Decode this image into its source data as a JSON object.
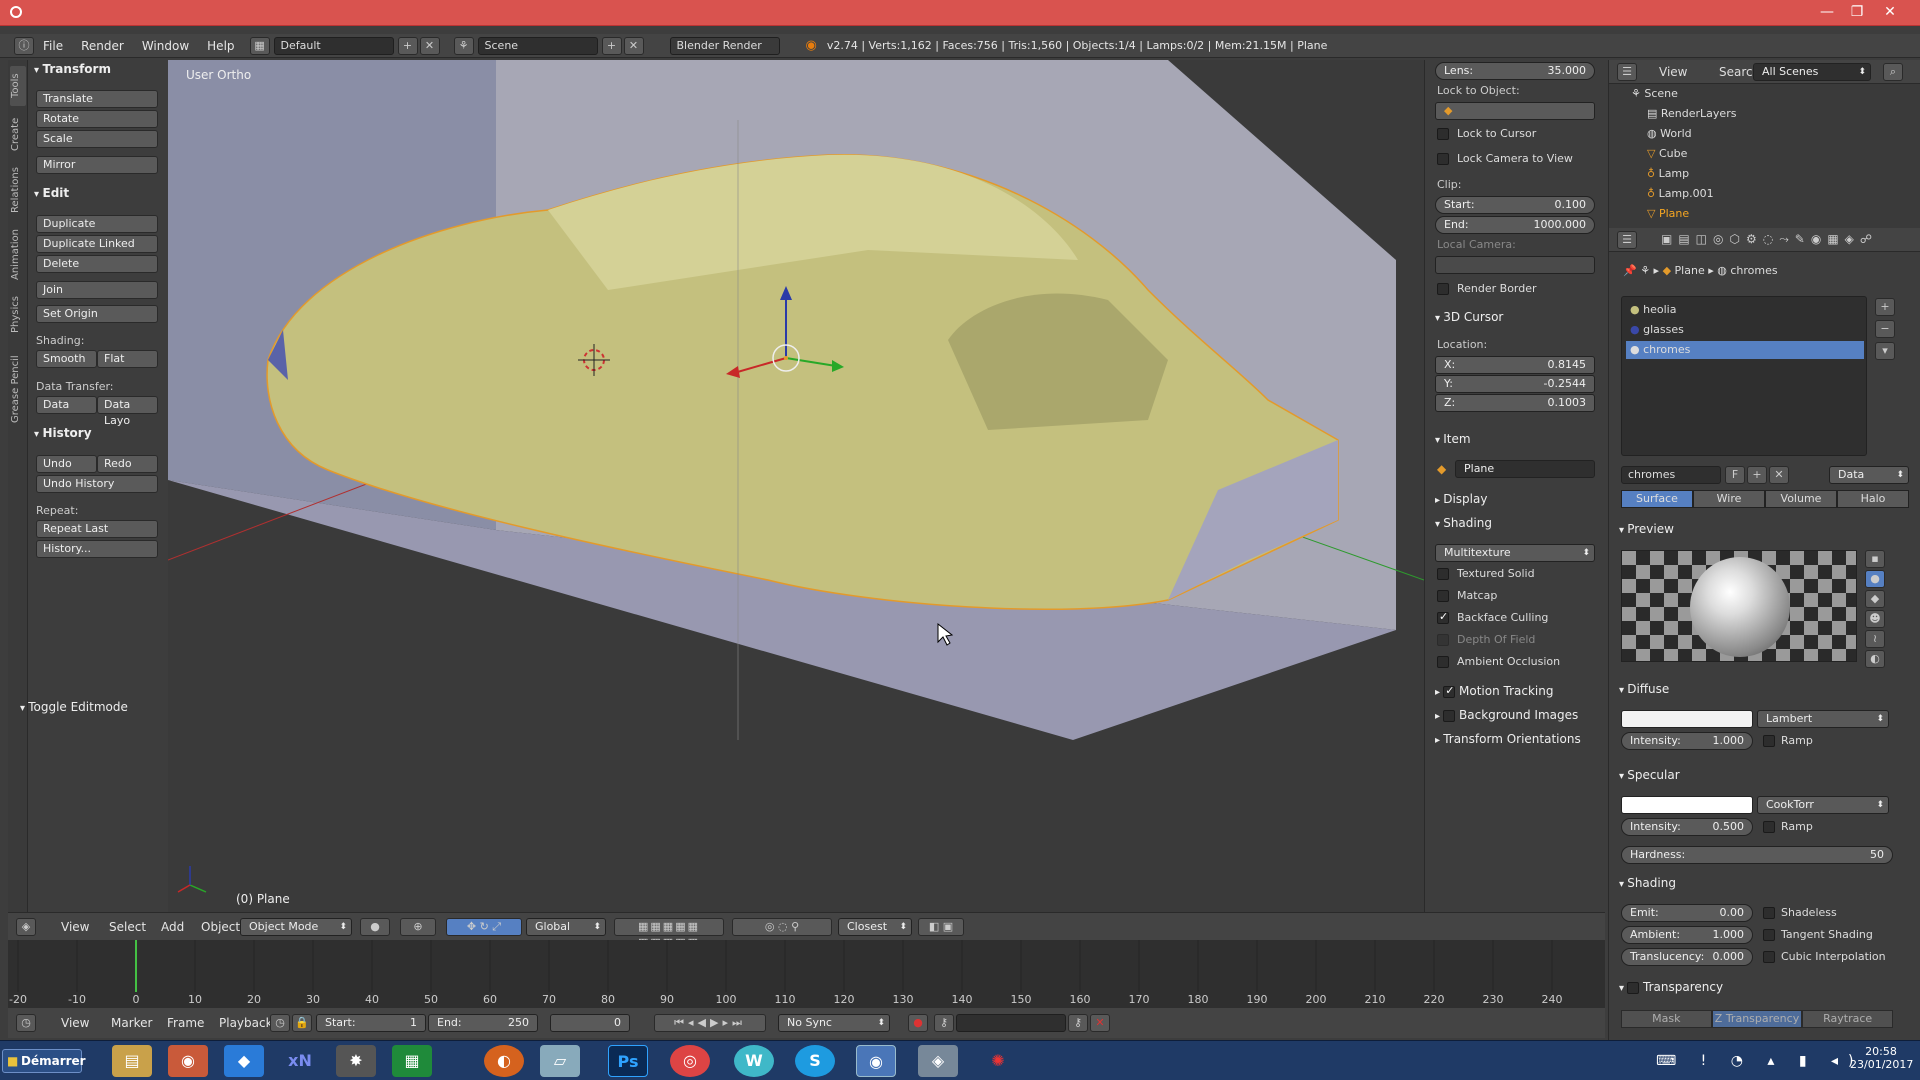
{
  "titlebar": {
    "min": "—",
    "max": "❐",
    "close": "✕"
  },
  "info": {
    "menus": [
      "File",
      "Render",
      "Window",
      "Help"
    ],
    "layout": "Default",
    "scene": "Scene",
    "engine": "Blender Render",
    "stats": "v2.74 | Verts:1,162 | Faces:756 | Tris:1,560 | Objects:1/4 | Lamps:0/2 | Mem:21.15M | Plane"
  },
  "tooltabs": [
    "Tools",
    "Create",
    "Relations",
    "Animation",
    "Physics",
    "Grease Pencil"
  ],
  "toolshelf": {
    "transform_header": "Transform",
    "translate": "Translate",
    "rotate": "Rotate",
    "scale": "Scale",
    "mirror": "Mirror",
    "edit_header": "Edit",
    "duplicate": "Duplicate",
    "duplicate_linked": "Duplicate Linked",
    "delete": "Delete",
    "join": "Join",
    "set_origin": "Set Origin",
    "shading_label": "Shading:",
    "smooth": "Smooth",
    "flat": "Flat",
    "data_transfer_label": "Data Transfer:",
    "data": "Data",
    "data_layout": "Data Layo",
    "history_header": "History",
    "undo": "Undo",
    "redo": "Redo",
    "undo_history": "Undo History",
    "repeat_label": "Repeat:",
    "repeat_last": "Repeat Last",
    "history": "History...",
    "toggle_editmode": "Toggle Editmode"
  },
  "viewport": {
    "view_label": "User Ortho",
    "object_label": "(0) Plane"
  },
  "npanel": {
    "lens_k": "Lens:",
    "lens_v": "35.000",
    "lock_to_object": "Lock to Object:",
    "lock_to_cursor": "Lock to Cursor",
    "lock_camera_to_view": "Lock Camera to View",
    "clip": "Clip:",
    "start_k": "Start:",
    "start_v": "0.100",
    "end_k": "End:",
    "end_v": "1000.000",
    "local_camera": "Local Camera:",
    "render_border": "Render Border",
    "cursor_header": "3D Cursor",
    "location": "Location:",
    "x_k": "X:",
    "x_v": "0.8145",
    "y_k": "Y:",
    "y_v": "-0.2544",
    "z_k": "Z:",
    "z_v": "0.1003",
    "item_header": "Item",
    "item_name": "Plane",
    "display_header": "Display",
    "shading_header": "Shading",
    "shading_mode": "Multitexture",
    "textured_solid": "Textured Solid",
    "matcap": "Matcap",
    "backface_culling": "Backface Culling",
    "depth_of_field": "Depth Of Field",
    "ambient_occlusion": "Ambient Occlusion",
    "motion_tracking": "Motion Tracking",
    "background_images": "Background Images",
    "transform_orientations": "Transform Orientations"
  },
  "outliner": {
    "view": "View",
    "search": "Search",
    "filter": "All Scenes",
    "rows": [
      "Scene",
      "RenderLayers",
      "World",
      "Cube",
      "Lamp",
      "Lamp.001",
      "Plane"
    ]
  },
  "props": {
    "crumb_object": "Plane",
    "crumb_material": "chromes",
    "slots": [
      "heolia",
      "glasses",
      "chromes"
    ],
    "material_name": "chromes",
    "f_label": "F",
    "data_dd": "Data",
    "tabs": [
      "Surface",
      "Wire",
      "Volume",
      "Halo"
    ],
    "preview_header": "Preview",
    "diffuse_header": "Diffuse",
    "diffuse_shader": "Lambert",
    "intensity_k": "Intensity:",
    "diffuse_intensity": "1.000",
    "ramp": "Ramp",
    "specular_header": "Specular",
    "specular_shader": "CookTorr",
    "specular_intensity": "0.500",
    "hardness_k": "Hardness:",
    "hardness_v": "50",
    "shading_header": "Shading",
    "emit_k": "Emit:",
    "emit_v": "0.00",
    "ambient_k": "Ambient:",
    "ambient_v": "1.000",
    "translucency_k": "Translucency:",
    "translucency_v": "0.000",
    "shadeless": "Shadeless",
    "tangent_shading": "Tangent Shading",
    "cubic_interpolation": "Cubic Interpolation",
    "transparency_header": "Transparency",
    "mask": "Mask",
    "z_transparency": "Z Transparency",
    "raytrace": "Raytrace"
  },
  "vpheader": {
    "view": "View",
    "select": "Select",
    "add": "Add",
    "object": "Object",
    "mode": "Object Mode",
    "orientation": "Global",
    "snap": "Closest"
  },
  "timeline": {
    "ticks": [
      "-20",
      "-10",
      "0",
      "10",
      "20",
      "30",
      "40",
      "50",
      "60",
      "70",
      "80",
      "90",
      "100",
      "110",
      "120",
      "130",
      "140",
      "150",
      "160",
      "170",
      "180",
      "190",
      "200",
      "210",
      "220",
      "230",
      "240"
    ],
    "current_frame": 0
  },
  "tlheader": {
    "view": "View",
    "marker": "Marker",
    "frame": "Frame",
    "playback": "Playback",
    "start_k": "Start:",
    "start_v": "1",
    "end_k": "End:",
    "end_v": "250",
    "cur": "0",
    "sync": "No Sync"
  },
  "taskbar": {
    "start": "Démarrer",
    "apps": [
      "xN",
      "Ps",
      "W",
      "S"
    ],
    "time": "20:58",
    "date": "23/01/2017"
  }
}
